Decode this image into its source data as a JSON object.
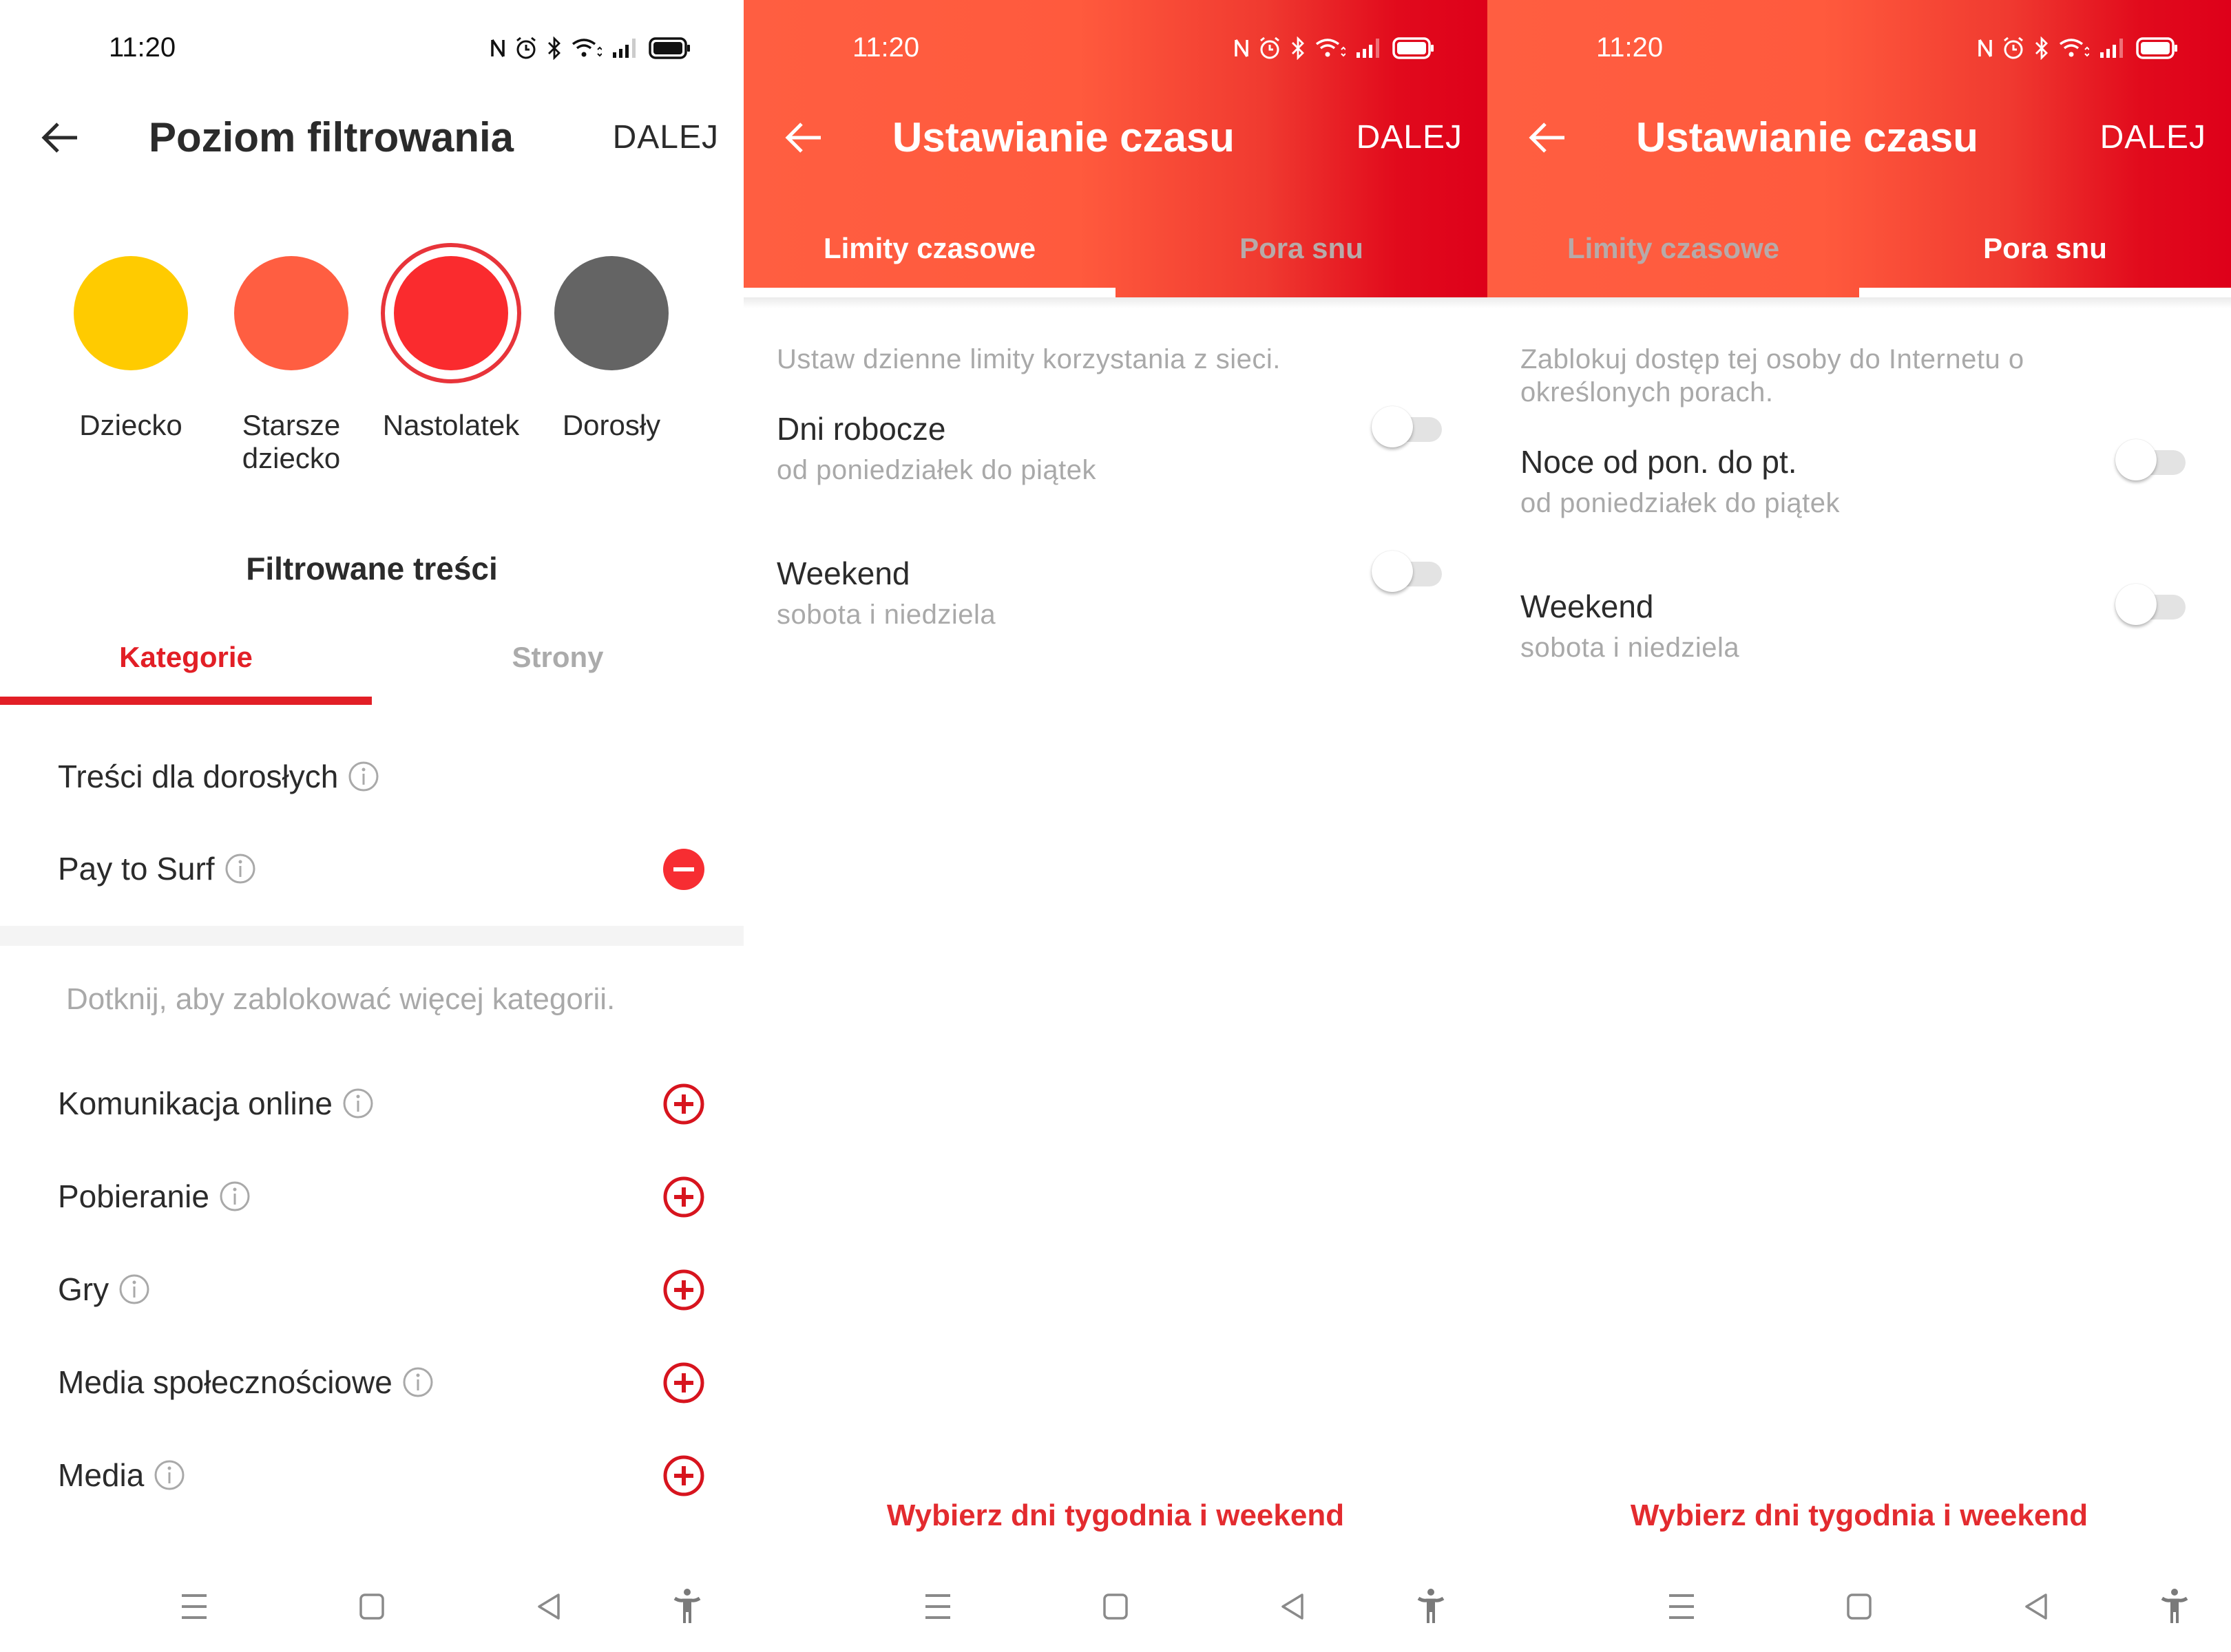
{
  "status_bar": {
    "time": "11:20",
    "icons": [
      "nfc-icon",
      "alarm-icon",
      "bluetooth-icon",
      "wifi-icon",
      "signal-icon",
      "battery-icon"
    ]
  },
  "colors": {
    "accent_red": "#e21f26",
    "header_gradient_start": "#ff5e41",
    "header_gradient_end": "#de001a",
    "muted_text": "#a9a9a9"
  },
  "screens": [
    {
      "header": {
        "back_icon": "arrow-left-icon",
        "title": "Poziom filtrowania",
        "next_label": "DALEJ"
      },
      "levels": [
        {
          "label_line1": "Dziecko",
          "label_line2": "",
          "color": "#ffcb00",
          "selected": false
        },
        {
          "label_line1": "Starsze",
          "label_line2": "dziecko",
          "color": "#ff5e41",
          "selected": false
        },
        {
          "label_line1": "Nastolatek",
          "label_line2": "",
          "color": "#fa2b2e",
          "selected": true
        },
        {
          "label_line1": "Dorosły",
          "label_line2": "",
          "color": "#646464",
          "selected": false
        }
      ],
      "section_title": "Filtrowane treści",
      "tabs": [
        {
          "label": "Kategorie",
          "active": true
        },
        {
          "label": "Strony",
          "active": false
        }
      ],
      "blocked_categories": [
        {
          "label": "Treści dla dorosłych",
          "info_icon": "info-icon",
          "action": "none"
        },
        {
          "label": "Pay to Surf",
          "info_icon": "info-icon",
          "action": "remove"
        }
      ],
      "hint": "Dotknij, aby zablokować więcej kategorii.",
      "available_categories": [
        {
          "label": "Komunikacja online",
          "info_icon": "info-icon",
          "action": "add"
        },
        {
          "label": "Pobieranie",
          "info_icon": "info-icon",
          "action": "add"
        },
        {
          "label": "Gry",
          "info_icon": "info-icon",
          "action": "add"
        },
        {
          "label": "Media społecznościowe",
          "info_icon": "info-icon",
          "action": "add"
        },
        {
          "label": "Media",
          "info_icon": "info-icon",
          "action": "add"
        }
      ]
    },
    {
      "header": {
        "back_icon": "arrow-left-icon",
        "title": "Ustawianie czasu",
        "next_label": "DALEJ"
      },
      "tabs": [
        {
          "label": "Limity czasowe",
          "active": true
        },
        {
          "label": "Pora snu",
          "active": false
        }
      ],
      "description": "Ustaw dzienne limity korzystania z sieci.",
      "settings": [
        {
          "title": "Dni robocze",
          "subtitle": "od poniedziałek do piątek",
          "enabled": false
        },
        {
          "title": "Weekend",
          "subtitle": "sobota i niedziela",
          "enabled": false
        }
      ],
      "bottom_link": "Wybierz dni tygodnia i weekend"
    },
    {
      "header": {
        "back_icon": "arrow-left-icon",
        "title": "Ustawianie czasu",
        "next_label": "DALEJ"
      },
      "tabs": [
        {
          "label": "Limity czasowe",
          "active": false
        },
        {
          "label": "Pora snu",
          "active": true
        }
      ],
      "description": "Zablokuj dostęp tej osoby do Internetu o określonych porach.",
      "settings": [
        {
          "title": "Noce od pon. do pt.",
          "subtitle": "od poniedziałek do piątek",
          "enabled": false
        },
        {
          "title": "Weekend",
          "subtitle": "sobota i niedziela",
          "enabled": false
        }
      ],
      "bottom_link": "Wybierz dni tygodnia i weekend"
    }
  ],
  "nav_bar": [
    {
      "name": "recents",
      "icon": "menu-lines-icon"
    },
    {
      "name": "home",
      "icon": "home-square-icon"
    },
    {
      "name": "back",
      "icon": "back-triangle-icon"
    },
    {
      "name": "accessibility",
      "icon": "accessibility-icon"
    }
  ]
}
